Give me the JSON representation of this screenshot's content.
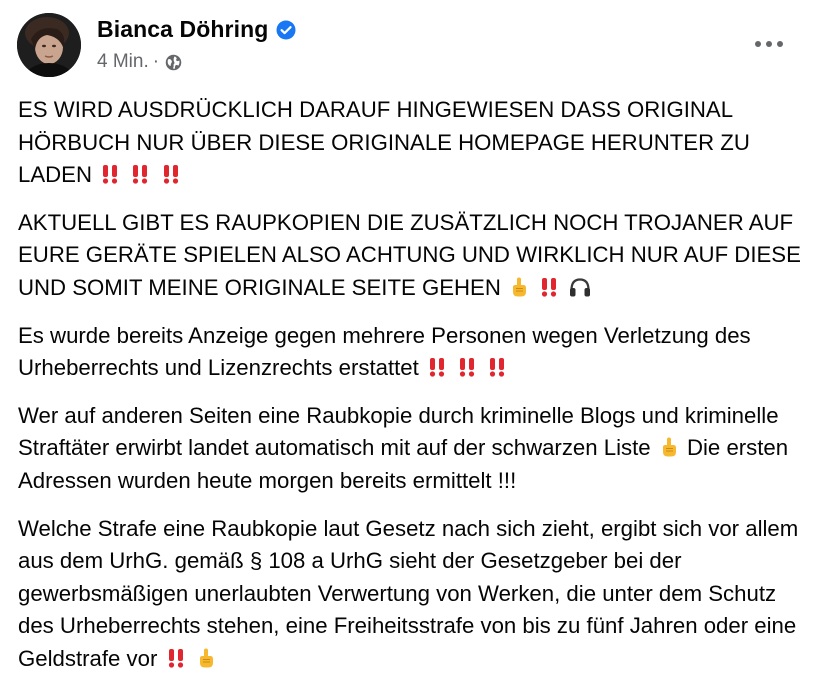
{
  "post": {
    "author": "Bianca Döhring",
    "timestamp": "4 Min.",
    "separator": "·",
    "privacy_icon": "globe-icon",
    "verified_icon": "verified-badge-icon",
    "more_icon": "more-options-icon",
    "accent_color": "#1877f2",
    "paragraphs": {
      "p1": "ES WIRD AUSDRÜCKLICH DARAUF HINGEWIESEN DASS ORIGINAL HÖRBUCH NUR ÜBER DIESE ORIGINALE HOMEPAGE HERUNTER ZU LADEN",
      "p2": "AKTUELL GIBT ES RAUPKOPIEN DIE ZUSÄTZLICH NOCH TROJANER AUF EURE GERÄTE SPIELEN ALSO ACHTUNG UND WIRKLICH NUR AUF DIESE UND SOMIT MEINE ORIGINALE SEITE GEHEN",
      "p3": "Es wurde bereits Anzeige gegen mehrere Personen wegen Verletzung des Urheberrechts und Lizenzrechts erstattet",
      "p4a": "Wer auf anderen Seiten eine Raubkopie durch kriminelle Blogs und kriminelle Straftäter erwirbt landet automatisch mit auf der schwarzen Liste",
      "p4b": "Die ersten Adressen wurden heute morgen bereits ermittelt !!!",
      "p5": "Welche Strafe eine Raubkopie laut Gesetz nach sich zieht, ergibt sich vor allem aus dem UrhG. gemäß § 108 a UrhG sieht der Gesetzgeber bei der gewerbsmäßigen unerlaubten Verwertung von Werken, die unter dem Schutz des Urheberrechts stehen, eine Freiheitsstrafe von bis zu fünf Jahren oder eine Geldstrafe vor"
    },
    "emoji_names": [
      "double-exclamation-icon",
      "pointing-up-hand-icon",
      "headphones-icon"
    ]
  }
}
